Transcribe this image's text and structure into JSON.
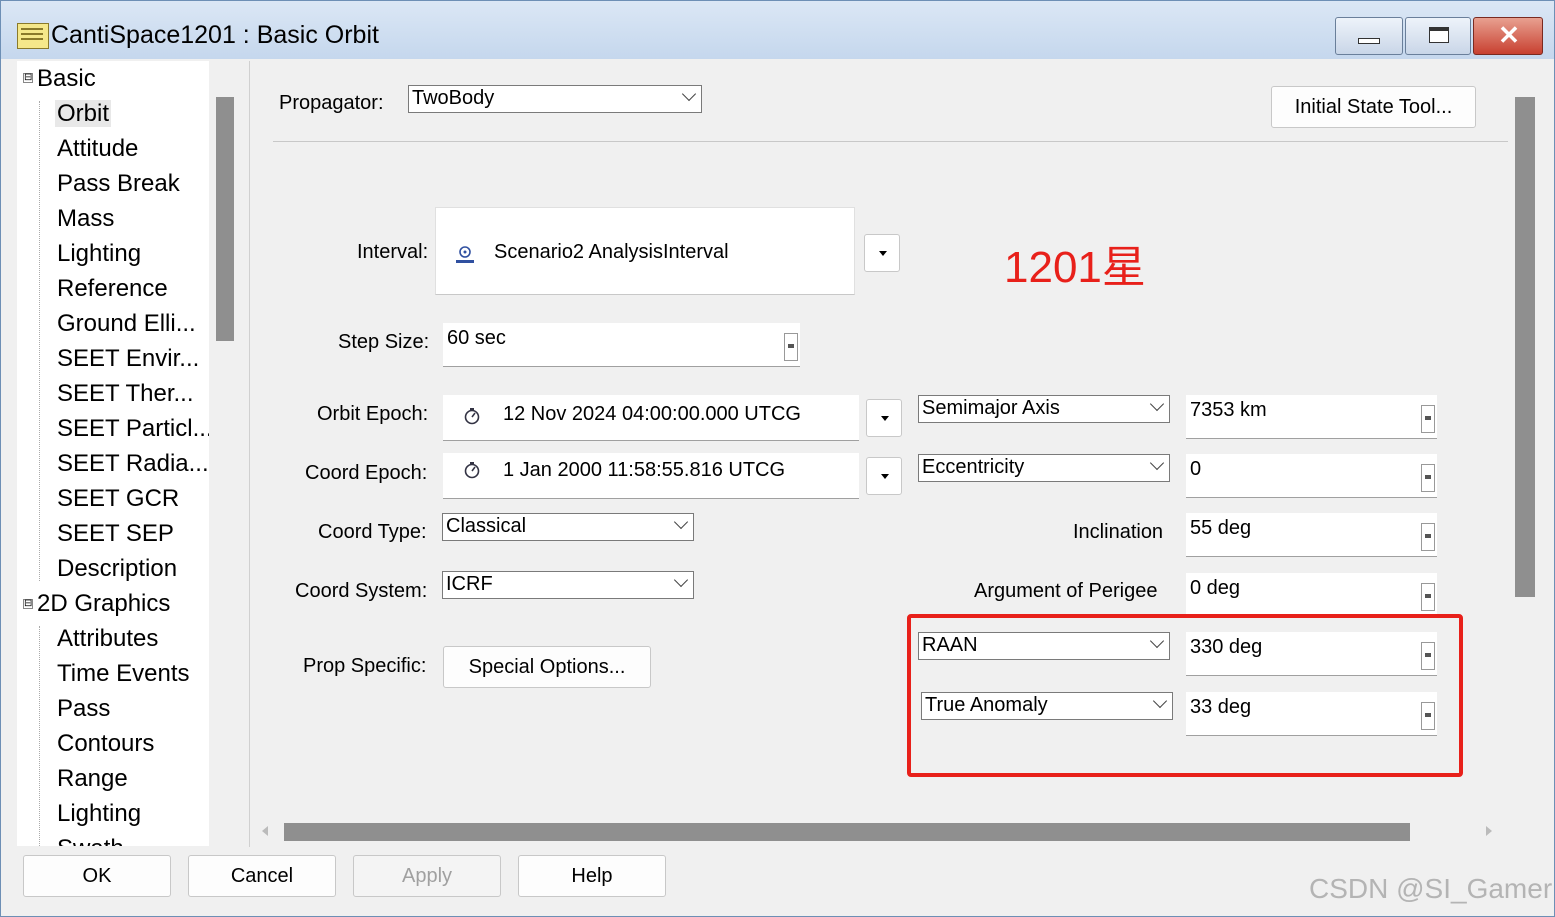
{
  "window": {
    "title": "CantiSpace1201 : Basic Orbit",
    "controls": {
      "minimize_icon": "minimize-icon",
      "maximize_icon": "maximize-icon",
      "close_icon": "close-icon",
      "close_glyph": "✕"
    }
  },
  "tree": {
    "groups": [
      {
        "label": "Basic",
        "expander": "⊟"
      },
      {
        "label": "2D Graphics",
        "expander": "⊟"
      }
    ],
    "basic_items": [
      "Orbit",
      "Attitude",
      "Pass Break",
      "Mass",
      "Lighting",
      "Reference",
      "Ground Elli...",
      "SEET Envir...",
      "SEET Ther...",
      "SEET Particl...",
      "SEET Radia...",
      "SEET GCR",
      "SEET SEP",
      "Description"
    ],
    "graphics_items": [
      "Attributes",
      "Time Events",
      "Pass",
      "Contours",
      "Range",
      "Lighting",
      "Swath"
    ],
    "selected": "Orbit"
  },
  "propagator": {
    "label": "Propagator:",
    "value": "TwoBody"
  },
  "initial_state_button": "Initial State Tool...",
  "interval": {
    "label": "Interval:",
    "value": "Scenario2 AnalysisInterval",
    "icon": "interval-object-icon"
  },
  "annotation": "1201星",
  "step_size": {
    "label": "Step Size:",
    "value": "60 sec"
  },
  "orbit_epoch": {
    "label": "Orbit Epoch:",
    "value": "12 Nov 2024 04:00:00.000 UTCG",
    "icon": "stopwatch-icon"
  },
  "coord_epoch": {
    "label": "Coord Epoch:",
    "value": "1 Jan 2000 11:58:55.816 UTCG",
    "icon": "stopwatch-icon"
  },
  "coord_type": {
    "label": "Coord Type:",
    "value": "Classical"
  },
  "coord_system": {
    "label": "Coord System:",
    "value": "ICRF"
  },
  "prop_specific": {
    "label": "Prop Specific:",
    "button": "Special Options..."
  },
  "elements": {
    "semimajor": {
      "selector": "Semimajor Axis",
      "value": "7353 km"
    },
    "eccentricity": {
      "selector": "Eccentricity",
      "value": "0"
    },
    "inclination": {
      "label": "Inclination",
      "value": "55 deg"
    },
    "arg_perigee": {
      "label": "Argument of Perigee",
      "value": "0 deg"
    },
    "raan": {
      "selector": "RAAN",
      "value": "330 deg"
    },
    "true_anomaly": {
      "selector": "True Anomaly",
      "value": "33 deg"
    }
  },
  "footer": {
    "ok": "OK",
    "cancel": "Cancel",
    "apply": "Apply",
    "help": "Help"
  },
  "watermark": "CSDN @SI_Gamer"
}
